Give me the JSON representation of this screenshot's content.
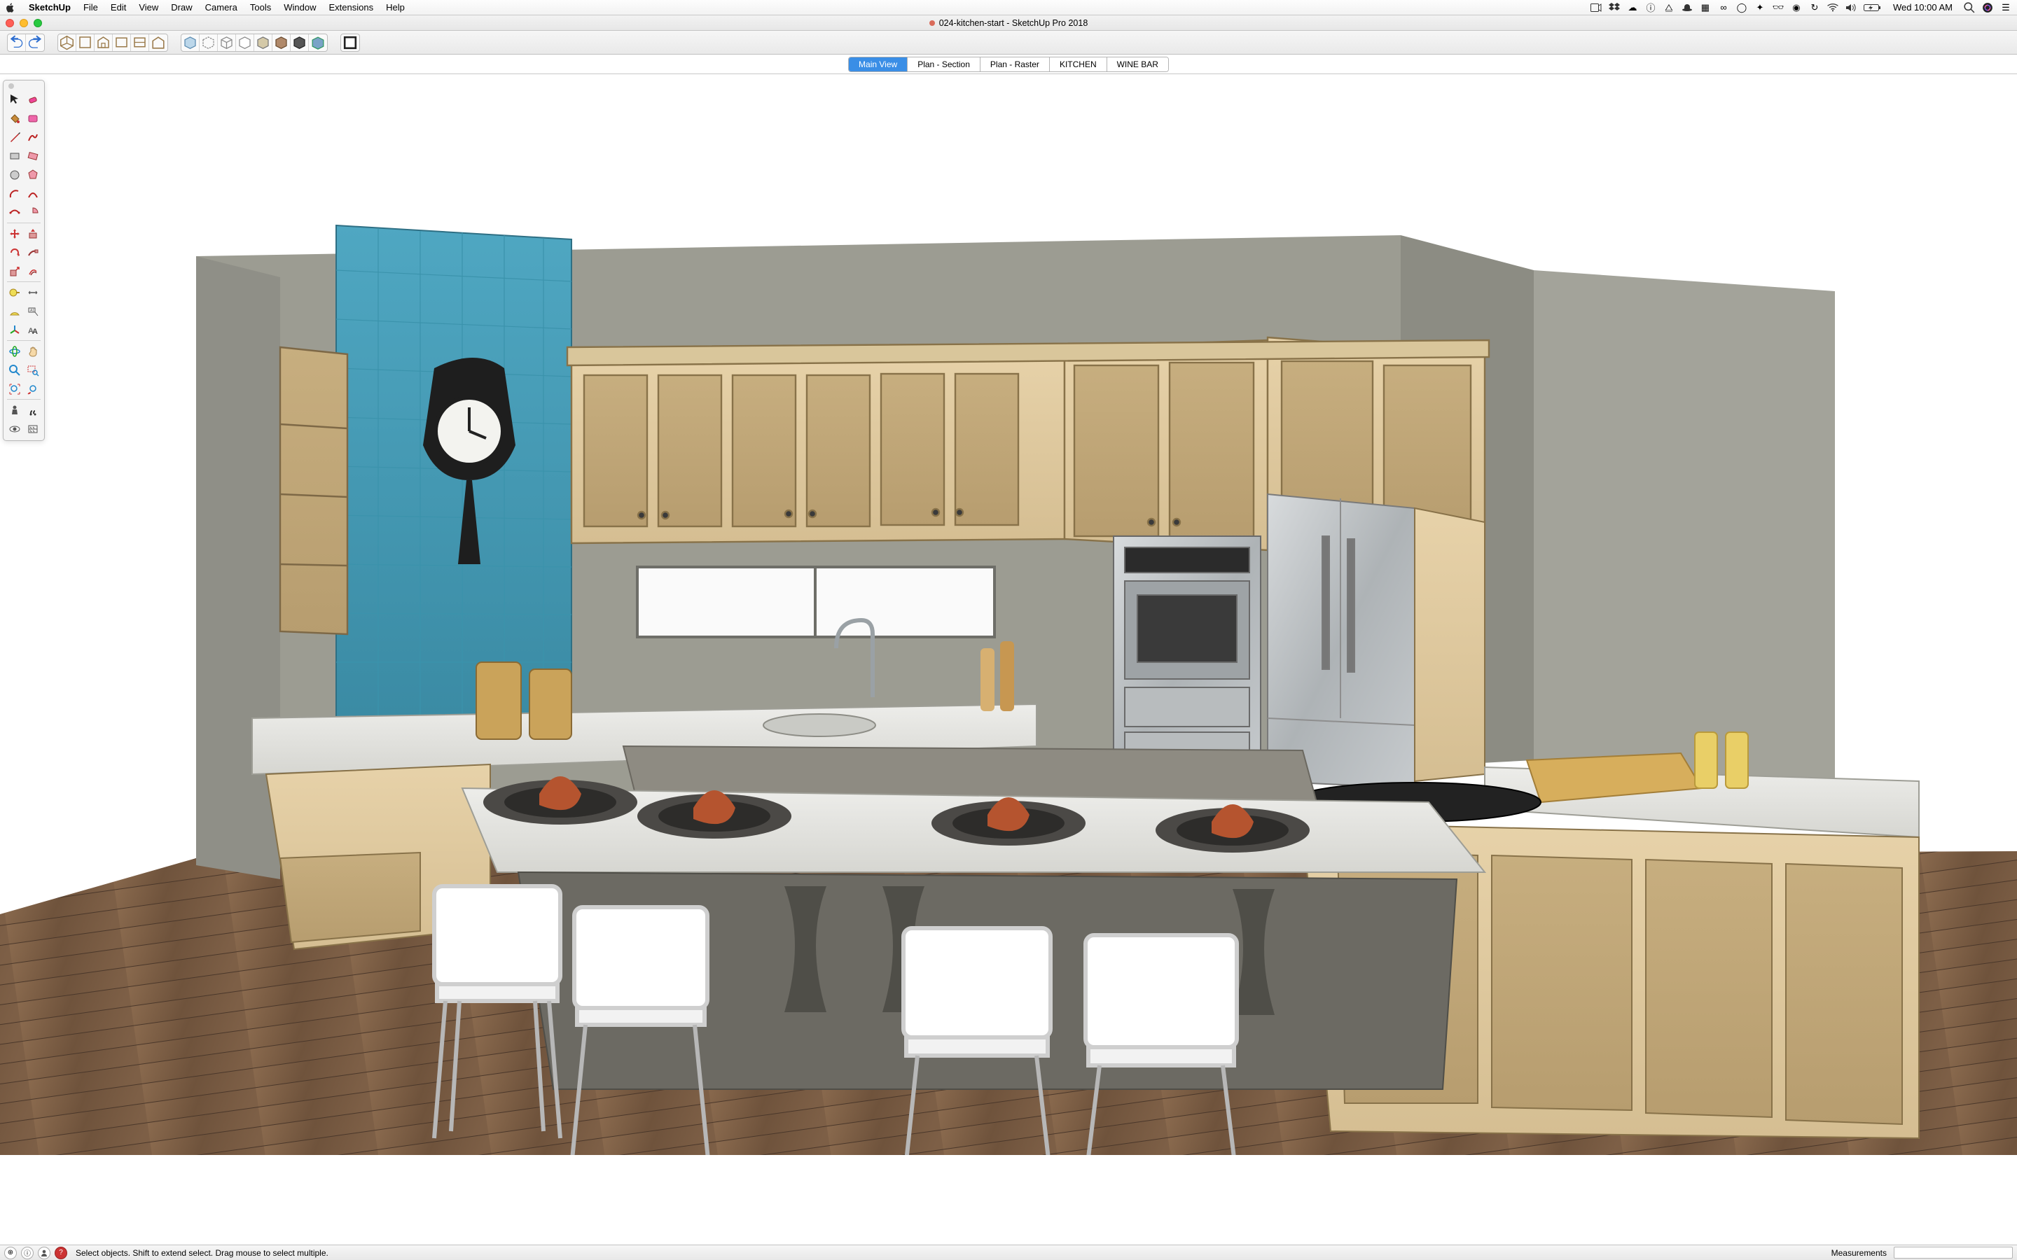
{
  "menubar": {
    "app": "SketchUp",
    "items": [
      "File",
      "Edit",
      "View",
      "Draw",
      "Camera",
      "Tools",
      "Window",
      "Extensions",
      "Help"
    ],
    "clock": "Wed 10:00 AM"
  },
  "window": {
    "title": "024-kitchen-start - SketchUp Pro 2018"
  },
  "scene_tabs": [
    {
      "label": "Main View",
      "active": true
    },
    {
      "label": "Plan - Section",
      "active": false
    },
    {
      "label": "Plan - Raster",
      "active": false
    },
    {
      "label": "KITCHEN",
      "active": false
    },
    {
      "label": "WINE BAR",
      "active": false
    }
  ],
  "statusbar": {
    "hint": "Select objects. Shift to extend select. Drag mouse to select multiple.",
    "measurements_label": "Measurements",
    "measurements_value": ""
  },
  "tools": {
    "rows": [
      [
        "select",
        "eraser"
      ],
      [
        "paint",
        "material"
      ],
      [
        "line",
        "freehand"
      ],
      [
        "rectangle",
        "rotated-rect"
      ],
      [
        "circle",
        "polygon"
      ],
      [
        "arc",
        "2pt-arc"
      ],
      [
        "3pt-arc",
        "pie"
      ],
      [],
      [
        "move",
        "rotate"
      ],
      [
        "scale",
        "pushpull"
      ],
      [
        "followme",
        "offset"
      ],
      [],
      [
        "tape",
        "protractor"
      ],
      [
        "dimension",
        "text"
      ],
      [
        "axes",
        "3dtext"
      ],
      [],
      [
        "orbit",
        "pan"
      ],
      [
        "zoom",
        "zoom-window"
      ],
      [
        "zoom-extents",
        "prev-view"
      ],
      [],
      [
        "position-cam",
        "walk"
      ],
      [
        "look",
        "section"
      ]
    ]
  }
}
